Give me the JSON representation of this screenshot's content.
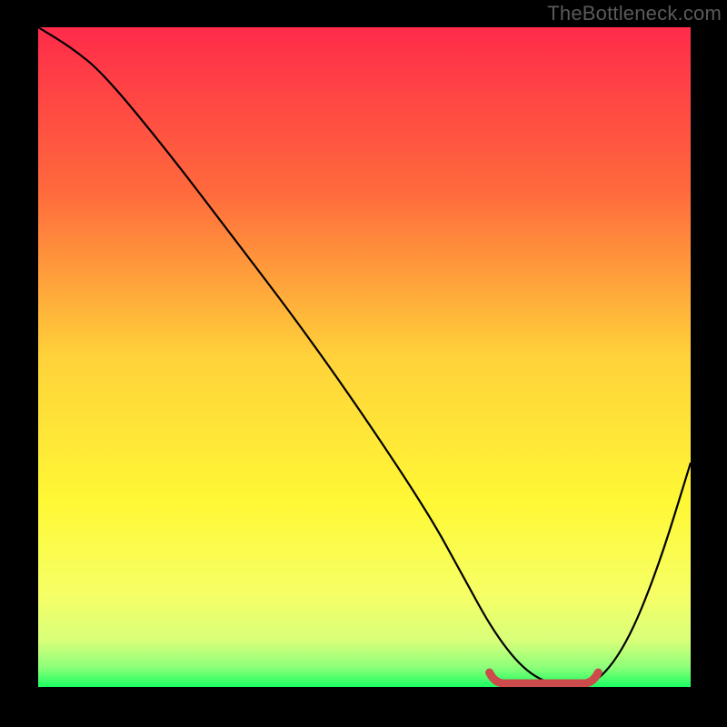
{
  "watermark": "TheBottleneck.com",
  "chart_data": {
    "type": "line",
    "title": "",
    "xlabel": "",
    "ylabel": "",
    "xlim": [
      0,
      100
    ],
    "ylim": [
      0,
      100
    ],
    "gradient_stops": [
      {
        "offset": 0,
        "color": "#ff2b4a"
      },
      {
        "offset": 0.25,
        "color": "#ff6a3c"
      },
      {
        "offset": 0.5,
        "color": "#ffd23a"
      },
      {
        "offset": 0.72,
        "color": "#fff835"
      },
      {
        "offset": 0.86,
        "color": "#f6ff66"
      },
      {
        "offset": 0.93,
        "color": "#d8ff7a"
      },
      {
        "offset": 0.97,
        "color": "#8dff79"
      },
      {
        "offset": 1.0,
        "color": "#1aff62"
      }
    ],
    "series": [
      {
        "name": "bottleneck-curve",
        "x": [
          0,
          5,
          10,
          20,
          30,
          40,
          50,
          60,
          65,
          70,
          75,
          80,
          85,
          90,
          95,
          100
        ],
        "values": [
          100,
          97,
          93,
          81,
          68,
          55,
          41,
          26,
          17,
          8,
          2,
          0,
          0,
          6,
          18,
          34
        ]
      }
    ],
    "optimal_zone": {
      "start_x": 70,
      "end_x": 85,
      "y": 0
    },
    "colors": {
      "curve": "#000000",
      "optimal_marker": "#cc4b4b",
      "background_frame": "#000000"
    }
  }
}
